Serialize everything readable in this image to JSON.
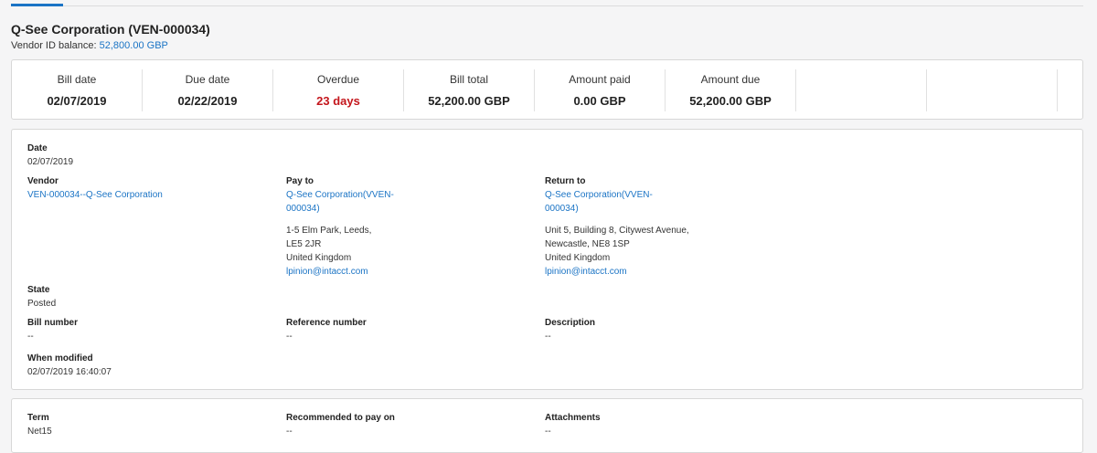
{
  "header": {
    "title": "Q-See Corporation (VEN-000034)",
    "balance_label": "Vendor ID balance:",
    "balance_value": "52,800.00",
    "balance_currency": "GBP"
  },
  "summary": [
    {
      "label": "Bill date",
      "value": "02/07/2019"
    },
    {
      "label": "Due date",
      "value": "02/22/2019"
    },
    {
      "label": "Overdue",
      "value": "23 days"
    },
    {
      "label": "Bill total",
      "value": "52,200.00 GBP"
    },
    {
      "label": "Amount paid",
      "value": "0.00 GBP"
    },
    {
      "label": "Amount due",
      "value": "52,200.00 GBP"
    }
  ],
  "details": {
    "date": {
      "label": "Date",
      "value": "02/07/2019"
    },
    "vendor": {
      "label": "Vendor",
      "value": "VEN-000034--Q-See Corporation"
    },
    "pay_to": {
      "label": "Pay to",
      "name_line1": "Q-See Corporation(VVEN-",
      "name_line2": "000034)",
      "addr1": "1-5 Elm Park, Leeds,",
      "addr2": "LE5 2JR",
      "addr3": "United Kingdom",
      "email": "lpinion@intacct.com"
    },
    "return_to": {
      "label": "Return to",
      "name_line1": "Q-See Corporation(VVEN-",
      "name_line2": "000034)",
      "addr1": "Unit 5, Building 8, Citywest Avenue,",
      "addr2": "Newcastle, NE8 1SP",
      "addr3": "United Kingdom",
      "email": "lpinion@intacct.com"
    },
    "state": {
      "label": "State",
      "value": "Posted"
    },
    "bill_number": {
      "label": "Bill number",
      "value": "--"
    },
    "reference_number": {
      "label": "Reference number",
      "value": "--"
    },
    "description": {
      "label": "Description",
      "value": "--"
    },
    "when_modified": {
      "label": "When modified",
      "value": "02/07/2019 16:40:07"
    }
  },
  "terms": {
    "term": {
      "label": "Term",
      "value": "Net15"
    },
    "recommended": {
      "label": "Recommended to pay on",
      "value": "--"
    },
    "attachments": {
      "label": "Attachments",
      "value": "--"
    }
  },
  "colors": {
    "accent": "#1b74c5",
    "overdue": "#c4161c"
  }
}
